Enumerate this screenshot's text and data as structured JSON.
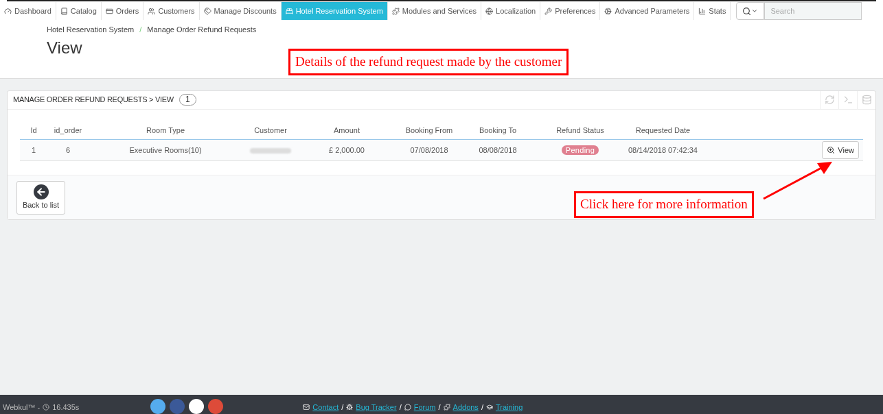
{
  "nav": {
    "items": [
      {
        "label": "Dashboard",
        "selected": false
      },
      {
        "label": "Catalog",
        "selected": false
      },
      {
        "label": "Orders",
        "selected": false
      },
      {
        "label": "Customers",
        "selected": false
      },
      {
        "label": "Manage Discounts",
        "selected": false
      },
      {
        "label": "Hotel Reservation System",
        "selected": true
      },
      {
        "label": "Modules and Services",
        "selected": false
      },
      {
        "label": "Localization",
        "selected": false
      },
      {
        "label": "Preferences",
        "selected": false
      },
      {
        "label": "Advanced Parameters",
        "selected": false
      },
      {
        "label": "Stats",
        "selected": false
      }
    ],
    "search": {
      "placeholder": "Search"
    }
  },
  "breadcrumb": {
    "items": [
      "Hotel Reservation System",
      "Manage Order Refund Requests"
    ],
    "separator": "/"
  },
  "page_title": "View",
  "annotations": [
    {
      "text": "Details of the refund request made by the customer"
    },
    {
      "text": "Click here for more information"
    }
  ],
  "panel": {
    "title": "MANAGE ORDER REFUND REQUESTS > VIEW",
    "count": "1",
    "table": {
      "columns": [
        "Id",
        "id_order",
        "Room Type",
        "Customer",
        "Amount",
        "Booking From",
        "Booking To",
        "Refund Status",
        "Requested Date"
      ],
      "rows": [
        {
          "id": "1",
          "id_order": "6",
          "room_type": "Executive Rooms(10)",
          "amount": "£ 2,000.00",
          "booking_from": "07/08/2018",
          "booking_to": "08/08/2018",
          "status": "Pending",
          "requested": "08/14/2018 07:42:34",
          "action": "View"
        }
      ]
    },
    "back_button": "Back to list"
  },
  "footer": {
    "brand": "Webkul™ -",
    "time": "16.435s",
    "links": [
      "Contact",
      "Bug Tracker",
      "Forum",
      "Addons",
      "Training"
    ],
    "separators": [
      "/",
      "/",
      "/",
      "/"
    ]
  }
}
